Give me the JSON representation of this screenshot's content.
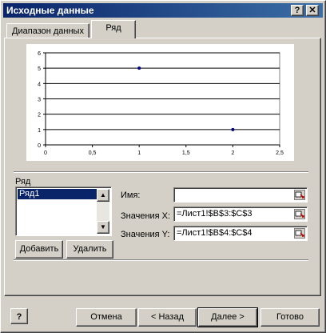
{
  "window": {
    "title": "Исходные данные",
    "help_button": "?",
    "close_button": "✕"
  },
  "tabs": [
    {
      "label": "Диапазон данных",
      "active": false
    },
    {
      "label": "Ряд",
      "active": true
    }
  ],
  "chart_data": {
    "type": "scatter",
    "x": [
      1,
      2
    ],
    "y": [
      5,
      1
    ],
    "xlim": [
      0,
      2.5
    ],
    "ylim": [
      0,
      6
    ],
    "xticks": [
      "0",
      "0,5",
      "1",
      "1,5",
      "2",
      "2,5"
    ],
    "yticks": [
      "0",
      "1",
      "2",
      "3",
      "4",
      "5",
      "6"
    ],
    "grid": true,
    "marker_color": "#000080"
  },
  "series_group": {
    "label": "Ряд",
    "items": [
      "Ряд1"
    ],
    "selected_index": 0,
    "add_label": "Добавить",
    "remove_label": "Удалить"
  },
  "fields": {
    "name": {
      "label": "Имя:",
      "value": ""
    },
    "x_values": {
      "label": "Значения X:",
      "value": "=Лист1!$B$3:$C$3"
    },
    "y_values": {
      "label": "Значения Y:",
      "value": "=Лист1!$B$4:$C$4"
    }
  },
  "footer": {
    "help_icon": "?",
    "cancel": "Отмена",
    "back": "< Назад",
    "next": "Далее >",
    "finish": "Готово"
  },
  "colors": {
    "titlebar": "#0a246a",
    "selection": "#0a246a",
    "face": "#d4d0c8"
  }
}
